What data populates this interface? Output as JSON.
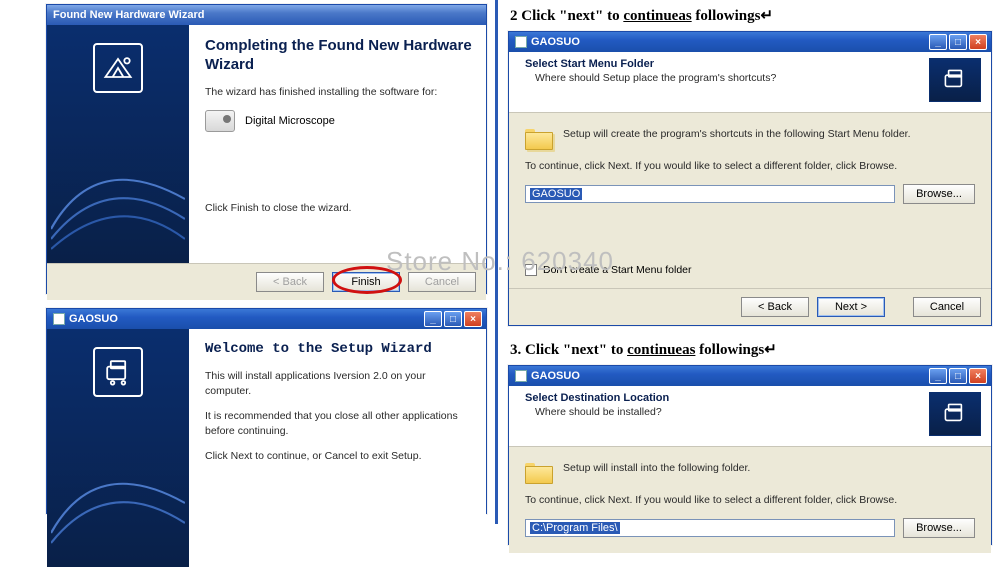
{
  "watermark": "Store No.: 620340",
  "dialog1": {
    "title": "Found New Hardware Wizard",
    "heading": "Completing the Found New Hardware Wizard",
    "text1": "The wizard has finished installing the software for:",
    "device": "Digital Microscope",
    "finish_note": "Click Finish to close the wizard.",
    "btn_back": "< Back",
    "btn_finish": "Finish",
    "btn_cancel": "Cancel"
  },
  "dialog2": {
    "title": "GAOSUO",
    "heading": "Welcome to the Setup Wizard",
    "line1": "This will install applications Iversion 2.0 on your computer.",
    "line2": "It is recommended that you close all other applications before continuing.",
    "line3": "Click Next to continue, or Cancel to exit Setup."
  },
  "step2": {
    "caption_pre": "2 Click \"next\" to ",
    "caption_u": "continueas",
    "caption_post": " followings",
    "title": "GAOSUO",
    "hdr_title": "Select Start Menu Folder",
    "hdr_sub": "Where should Setup place the program's shortcuts?",
    "body1": "Setup will create the program's shortcuts in the following Start Menu folder.",
    "body2": "To continue, click Next. If you would like to select a different folder, click Browse.",
    "path_value": "GAOSUO",
    "browse": "Browse...",
    "checkbox_label": "Don't create a Start Menu folder",
    "btn_back": "< Back",
    "btn_next": "Next >",
    "btn_cancel": "Cancel"
  },
  "step3": {
    "caption_pre": "3. Click \"next\" to ",
    "caption_u": "continueas",
    "caption_post": " followings",
    "title": "GAOSUO",
    "hdr_title": "Select Destination Location",
    "hdr_sub": "Where should  be installed?",
    "body1": "Setup will install into the following folder.",
    "body2": "To continue, click Next. If you would like to select a different folder, click Browse.",
    "path_value": "C:\\Program Files\\",
    "browse": "Browse..."
  }
}
